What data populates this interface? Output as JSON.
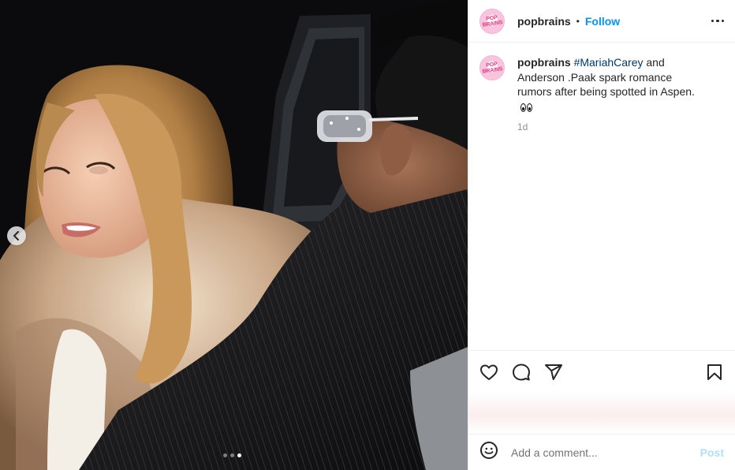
{
  "post": {
    "username": "popbrains",
    "separator": "•",
    "follow_label": "Follow",
    "avatar_text": "POP BRAINS",
    "caption": {
      "username": "popbrains",
      "hashtag": "#MariahCarey",
      "text": " and Anderson .Paak spark romance rumors after being spotted in Aspen.",
      "emoji": "eyes-emoji"
    },
    "timestamp": "1d",
    "carousel": {
      "slide_count": 3,
      "active_index": 2
    }
  },
  "icons": {
    "prev": "chevron-left-icon",
    "more": "more-horizontal-icon",
    "like": "heart-icon",
    "comment": "comment-icon",
    "share": "share-icon",
    "save": "bookmark-icon",
    "emoji": "emoji-icon"
  },
  "comment": {
    "placeholder": "Add a comment...",
    "post_label": "Post"
  },
  "colors": {
    "accent": "#0095f6",
    "hashtag": "#00376b",
    "post_disabled": "#b2dffc",
    "muted": "#8e8e8e"
  }
}
